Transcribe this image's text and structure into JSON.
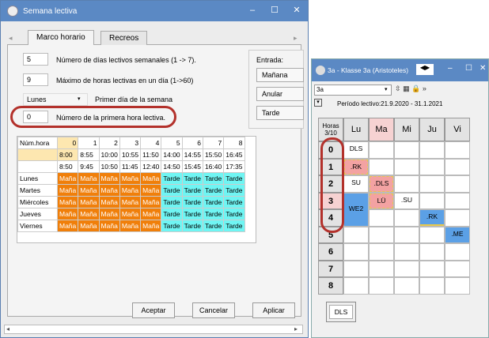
{
  "dialog1": {
    "title": "Semana lectiva",
    "tabs": [
      "Marco horario",
      "Recreos"
    ],
    "fields": [
      {
        "value": "5",
        "label": "Número de días lectivos semanales (1 -> 7)."
      },
      {
        "value": "9",
        "label": "Máximo de horas lectivas en un día (1->60)"
      },
      {
        "value": "Lunes",
        "label": "Primer día de la semana"
      },
      {
        "value": "0",
        "label": "Número de la primera hora lectiva."
      }
    ],
    "entrada": {
      "label": "Entrada:",
      "buttons": [
        "Mañana",
        "Anular",
        "Tarde"
      ]
    },
    "table": {
      "header_label": "Núm.hora",
      "hours": [
        "0",
        "1",
        "2",
        "3",
        "4",
        "5",
        "6",
        "7",
        "8"
      ],
      "starts": [
        "8:00",
        "8:55",
        "10:00",
        "10:55",
        "11:50",
        "14:00",
        "14:55",
        "15:50",
        "16:45"
      ],
      "ends": [
        "8:50",
        "9:45",
        "10:50",
        "11:45",
        "12:40",
        "14:50",
        "15:45",
        "16:40",
        "17:35"
      ],
      "days": [
        "Lunes",
        "Martes",
        "Miércoles",
        "Jueves",
        "Viernes"
      ],
      "morning": "Maña",
      "afternoon": "Tarde"
    },
    "buttons": {
      "accept": "Aceptar",
      "cancel": "Cancelar",
      "apply": "Aplicar"
    },
    "colors": {
      "morning": "#f07f0a",
      "afternoon": "#6ff5f3",
      "highlight_oval": "#b3312b"
    }
  },
  "dialog2": {
    "title": "3a - Klasse 3a (Aristoteles)",
    "class_select": "3a",
    "period": "Período lectivo:21.9.2020 - 31.1.2021",
    "corner": "Horas\n3/10",
    "days": [
      "Lu",
      "Ma",
      "Mi",
      "Ju",
      "Vi"
    ],
    "hours": [
      "0",
      "1",
      "2",
      "3",
      "4",
      "5",
      "6",
      "7",
      "8"
    ],
    "lessons": {
      "dls": "DLS",
      "rk": ".RK",
      "su": "SU",
      "dls2": ".DLS",
      "lu": "LÜ",
      "su2": ".SU",
      "we2": "WE2",
      "rk2": ".RK",
      "me": ".ME"
    },
    "bottom_tab": "DLS"
  }
}
